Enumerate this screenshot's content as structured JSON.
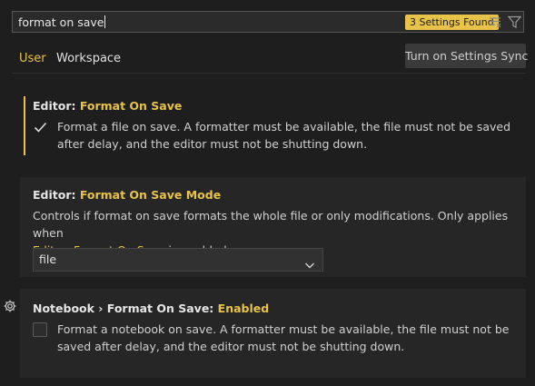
{
  "search": {
    "value": "format on save",
    "badge": "3 Settings Found"
  },
  "tabs": [
    {
      "label": "User"
    },
    {
      "label": "Workspace"
    }
  ],
  "sync_button": "Turn on Settings Sync",
  "settings": [
    {
      "prefix": "Editor: ",
      "name": "Format On Save",
      "description": "Format a file on save. A formatter must be available, the file must not be saved after delay, and the editor must not be shutting down.",
      "checked": true
    },
    {
      "prefix": "Editor: ",
      "name": "Format On Save Mode",
      "description_pre": "Controls if format on save formats the whole file or only modifications. Only applies when",
      "link": "Editor: Format On Save",
      "description_post": " is enabled.",
      "selected": "file"
    },
    {
      "prefix": "Notebook › Format On Save: ",
      "name": "Enabled",
      "description": "Format a notebook on save. A formatter must be available, the file must not be saved after delay, and the editor must not be shutting down.",
      "checked": false
    }
  ],
  "colors": {
    "accent": "#e8c34a",
    "background": "#1e1e1e",
    "panel": "#262626"
  }
}
